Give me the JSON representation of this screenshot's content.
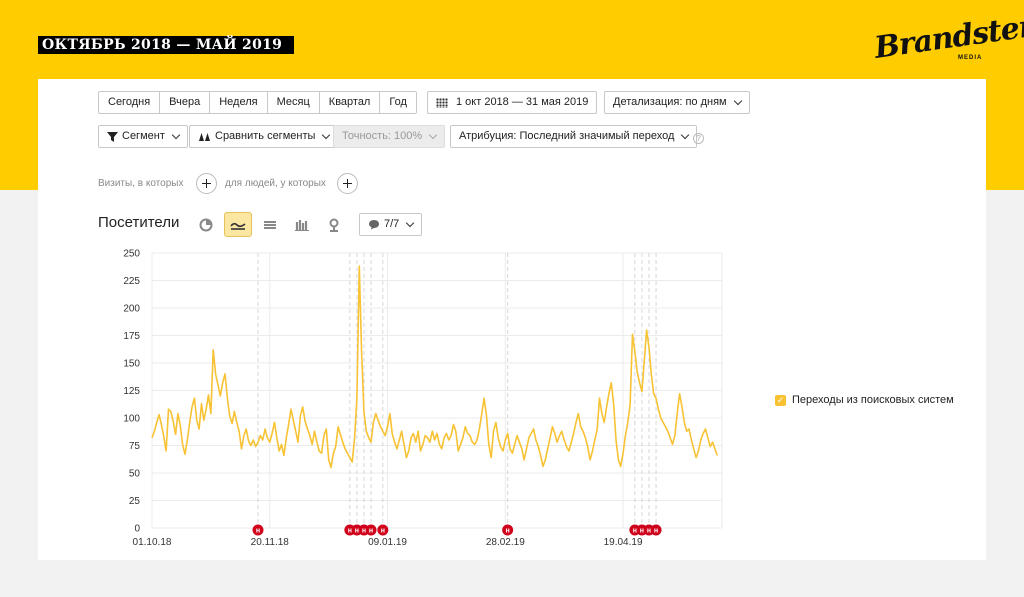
{
  "slide": {
    "title": "ОКТЯБРЬ 2018 — МАЙ 2019"
  },
  "logo": {
    "brand": "Brandster",
    "media": "MEDIA"
  },
  "toolbar": {
    "periods": [
      "Сегодня",
      "Вчера",
      "Неделя",
      "Месяц",
      "Квартал",
      "Год"
    ],
    "date_range": "1 окт 2018 — 31 мая 2019",
    "detail": "Детализация: по дням",
    "segment": "Сегмент",
    "compare": "Сравнить сегменты",
    "accuracy": "Точность: 100%",
    "attribution": "Атрибуция: Последний значимый переход",
    "help": "?"
  },
  "filters": {
    "visits_label": "Визиты, в которых",
    "people_label": "для людей, у которых"
  },
  "chart_header": {
    "title": "Посетители",
    "comments": "7/7"
  },
  "colors": {
    "line": "#f7c233",
    "marker": "#d0021b",
    "brand_yellow": "#ffcc00"
  },
  "chart_data": {
    "type": "line",
    "title": "",
    "xlabel": "",
    "ylabel": "",
    "ylim": [
      0,
      250
    ],
    "yticks": [
      0,
      25,
      50,
      75,
      100,
      125,
      150,
      175,
      200,
      225,
      250
    ],
    "x_range": [
      "2018-10-01",
      "2019-05-31"
    ],
    "xticks": [
      {
        "date": "2018-10-01",
        "label": "01.10.18"
      },
      {
        "date": "2018-11-20",
        "label": "20.11.18"
      },
      {
        "date": "2019-01-09",
        "label": "09.01.19"
      },
      {
        "date": "2019-02-28",
        "label": "28.02.19"
      },
      {
        "date": "2019-04-19",
        "label": "19.04.19"
      }
    ],
    "grid": true,
    "legend_position": "right",
    "series": [
      {
        "name": "Переходы из поисковых систем",
        "x_start": "2018-10-01",
        "step": "day",
        "values": [
          82,
          88,
          96,
          103,
          94,
          83,
          70,
          108,
          106,
          97,
          85,
          104,
          93,
          76,
          67,
          80,
          96,
          110,
          118,
          98,
          90,
          113,
          98,
          108,
          121,
          104,
          162,
          140,
          130,
          120,
          132,
          140,
          118,
          102,
          95,
          106,
          96,
          88,
          72,
          84,
          90,
          79,
          75,
          80,
          74,
          78,
          84,
          80,
          90,
          82,
          78,
          86,
          96,
          82,
          70,
          76,
          66,
          82,
          94,
          108,
          98,
          88,
          78,
          102,
          110,
          97,
          90,
          84,
          76,
          88,
          78,
          70,
          68,
          84,
          90,
          62,
          55,
          68,
          74,
          92,
          85,
          78,
          72,
          68,
          64,
          60,
          82,
          118,
          238,
          160,
          105,
          88,
          82,
          78,
          96,
          104,
          98,
          92,
          88,
          84,
          92,
          104,
          86,
          78,
          72,
          80,
          88,
          76,
          64,
          70,
          82,
          86,
          78,
          88,
          70,
          76,
          84,
          82,
          78,
          88,
          80,
          86,
          76,
          72,
          82,
          86,
          80,
          84,
          94,
          88,
          70,
          76,
          82,
          92,
          86,
          84,
          78,
          76,
          80,
          90,
          104,
          118,
          102,
          76,
          64,
          88,
          96,
          82,
          74,
          70,
          80,
          86,
          72,
          68,
          76,
          84,
          78,
          72,
          62,
          72,
          82,
          86,
          90,
          80,
          74,
          66,
          56,
          62,
          72,
          82,
          92,
          86,
          78,
          84,
          88,
          80,
          74,
          70,
          78,
          86,
          96,
          104,
          92,
          88,
          82,
          74,
          62,
          70,
          80,
          90,
          118,
          104,
          96,
          110,
          122,
          132,
          112,
          80,
          62,
          56,
          68,
          84,
          96,
          112,
          176,
          160,
          142,
          132,
          124,
          152,
          180,
          164,
          140,
          122,
          118,
          108,
          100,
          96,
          92,
          88,
          82,
          76,
          84,
          104,
          122,
          110,
          96,
          88,
          90,
          80,
          72,
          64,
          70,
          80,
          86,
          90,
          82,
          74,
          78,
          72,
          66
        ]
      }
    ],
    "annotations": [
      {
        "date": "2018-11-15",
        "label": "н"
      },
      {
        "date": "2018-12-24",
        "label": "н"
      },
      {
        "date": "2018-12-27",
        "label": "н"
      },
      {
        "date": "2018-12-30",
        "label": "н"
      },
      {
        "date": "2019-01-02",
        "label": "н"
      },
      {
        "date": "2019-01-07",
        "label": "н"
      },
      {
        "date": "2019-03-01",
        "label": "н"
      },
      {
        "date": "2019-04-24",
        "label": "н"
      },
      {
        "date": "2019-04-27",
        "label": "н"
      },
      {
        "date": "2019-04-30",
        "label": "н"
      },
      {
        "date": "2019-05-03",
        "label": "н"
      }
    ]
  }
}
